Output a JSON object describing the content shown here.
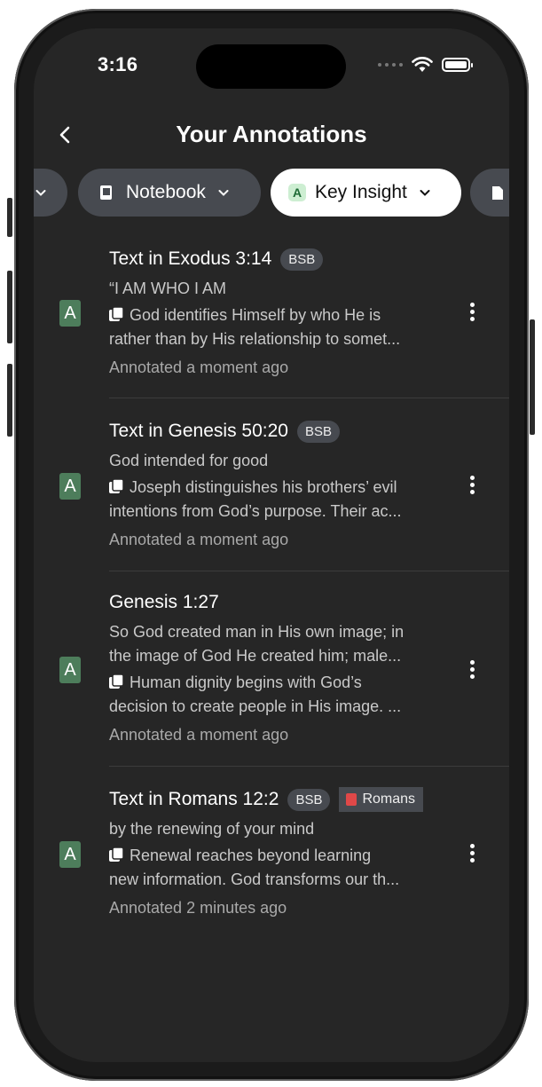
{
  "status_bar": {
    "time": "3:16",
    "battery_level": 1.0
  },
  "nav": {
    "title": "Your Annotations"
  },
  "filters": {
    "notebook_label": "Notebook",
    "key_insight_label": "Key Insight",
    "key_insight_badge": "A"
  },
  "annotations": [
    {
      "title": "Text in Exodus 3:14",
      "version": "BSB",
      "quote": "“I AM WHO I AM",
      "note_line1": "God identifies Himself by who He is",
      "note_line2": "rather than by His relationship to somet...",
      "meta": "Annotated a moment ago",
      "badge": "A"
    },
    {
      "title": "Text in Genesis 50:20",
      "version": "BSB",
      "quote": "God intended for good",
      "note_line1": "Joseph distinguishes his brothers’ evil",
      "note_line2": "intentions from God’s purpose. Their ac...",
      "meta": "Annotated a moment ago",
      "badge": "A"
    },
    {
      "title": "Genesis 1:27",
      "quote_line1": "So God created man in His own image; in",
      "quote_line2": "the image of God He created him; male...",
      "note_line1": "Human dignity begins with God’s",
      "note_line2": "decision to create people in His image. ...",
      "meta": "Annotated a moment ago",
      "badge": "A"
    },
    {
      "title": "Text in Romans 12:2",
      "version": "BSB",
      "tag": "Romans",
      "quote": "by the renewing of your mind",
      "note_line1": "Renewal reaches beyond learning",
      "note_line2": "new information. God transforms our th...",
      "meta": "Annotated 2 minutes ago",
      "badge": "A"
    }
  ],
  "colors": {
    "background": "#262626",
    "badge_green": "#4d7d5b",
    "chip_dark": "#474a50",
    "chip_light": "#ffffff",
    "tag_book_red": "#e04848"
  }
}
